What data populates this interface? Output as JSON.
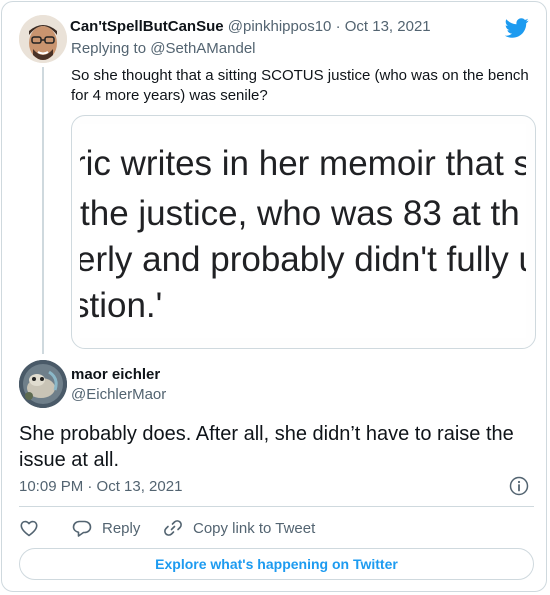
{
  "reply_tweet": {
    "display_name": "Can'tSpellButCanSue",
    "handle": "@pinkhippos10",
    "separator": "·",
    "date": "Oct 13, 2021",
    "replying_label": "Replying to",
    "replying_mention": "@SethAMandel",
    "text": "So she thought that a sitting SCOTUS justice (who was on the bench for 4 more years) was senile?",
    "image_lines": [
      "ric writes in her memoir that s",
      "the justice, who was 83 at th",
      "erly and probably didn't fully u",
      "stion.'"
    ]
  },
  "main_tweet": {
    "display_name": "maor eichler",
    "handle": "@EichlerMaor",
    "text": "She probably does. After all, she didn’t have to raise the issue at all.",
    "timestamp": "10:09 PM · Oct 13, 2021"
  },
  "actions": {
    "reply_label": "Reply",
    "copy_link_label": "Copy link to Tweet"
  },
  "footer": {
    "explore_label": "Explore what's happening on Twitter"
  },
  "colors": {
    "accent": "#1d9bf0",
    "secondary_text": "#536471",
    "border": "#cfd9de"
  },
  "icons": [
    "twitter-bird-icon",
    "info-icon",
    "heart-icon",
    "reply-bubble-icon",
    "link-icon"
  ]
}
